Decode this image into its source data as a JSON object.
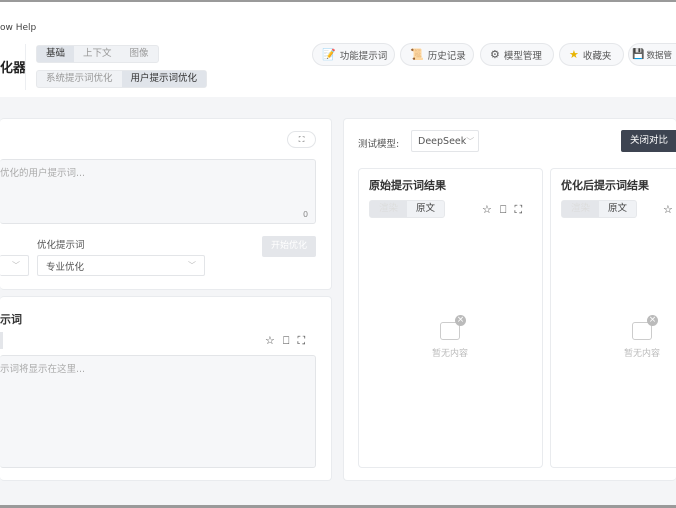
{
  "menu": "ow  Help",
  "app_title": "化器",
  "mode_tabs": [
    "基础",
    "上下文",
    "图像"
  ],
  "type_tabs": [
    "系统提示词优化",
    "用户提示词优化"
  ],
  "header_buttons": [
    {
      "label": "功能提示词",
      "icon": "template-icon"
    },
    {
      "label": "历史记录",
      "icon": "scroll-icon"
    },
    {
      "label": "模型管理",
      "icon": "gear-icon"
    },
    {
      "label": "收藏夹",
      "icon": "star-icon"
    },
    {
      "label": "数据管",
      "icon": "floppy-icon"
    }
  ],
  "input": {
    "placeholder": "优化的用户提示词...",
    "count": "0",
    "template_label": "优化提示词",
    "template_value": "专业优化",
    "optimize_button": "开始优化"
  },
  "output": {
    "title": "示词",
    "placeholder": "示词将显示在这里..."
  },
  "test": {
    "model_label": "测试模型:",
    "model_value": "DeepSeek",
    "close_compare": "关闭对比",
    "original_title": "原始提示词结果",
    "optimized_title": "优化后提示词结果",
    "render_label": "渲染",
    "raw_label": "原文",
    "empty_text": "暂无内容"
  },
  "colors": {
    "dark_button": "#3d4451",
    "background": "#f4f5f7"
  }
}
